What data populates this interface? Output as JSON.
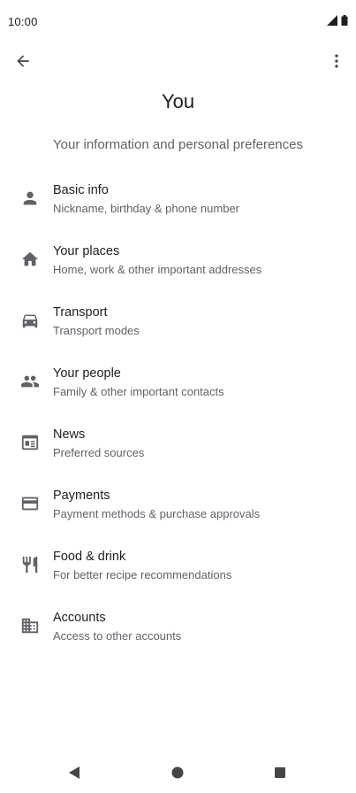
{
  "status_bar": {
    "time": "10:00"
  },
  "header": {
    "title": "You",
    "subtitle": "Your information and personal preferences"
  },
  "menu": [
    {
      "label": "Basic info",
      "description": "Nickname, birthday & phone number",
      "icon": "person-icon"
    },
    {
      "label": "Your places",
      "description": "Home, work & other important addresses",
      "icon": "home-icon"
    },
    {
      "label": "Transport",
      "description": "Transport modes",
      "icon": "car-icon"
    },
    {
      "label": "Your people",
      "description": "Family & other important contacts",
      "icon": "people-icon"
    },
    {
      "label": "News",
      "description": "Preferred sources",
      "icon": "news-icon"
    },
    {
      "label": "Payments",
      "description": "Payment methods & purchase approvals",
      "icon": "credit-card-icon"
    },
    {
      "label": "Food & drink",
      "description": "For better recipe recommendations",
      "icon": "restaurant-icon"
    },
    {
      "label": "Accounts",
      "description": "Access to other accounts",
      "icon": "building-icon"
    }
  ],
  "colors": {
    "icon": "#5f6368",
    "text_primary": "#1f1f1f",
    "text_secondary": "#5f6368"
  }
}
